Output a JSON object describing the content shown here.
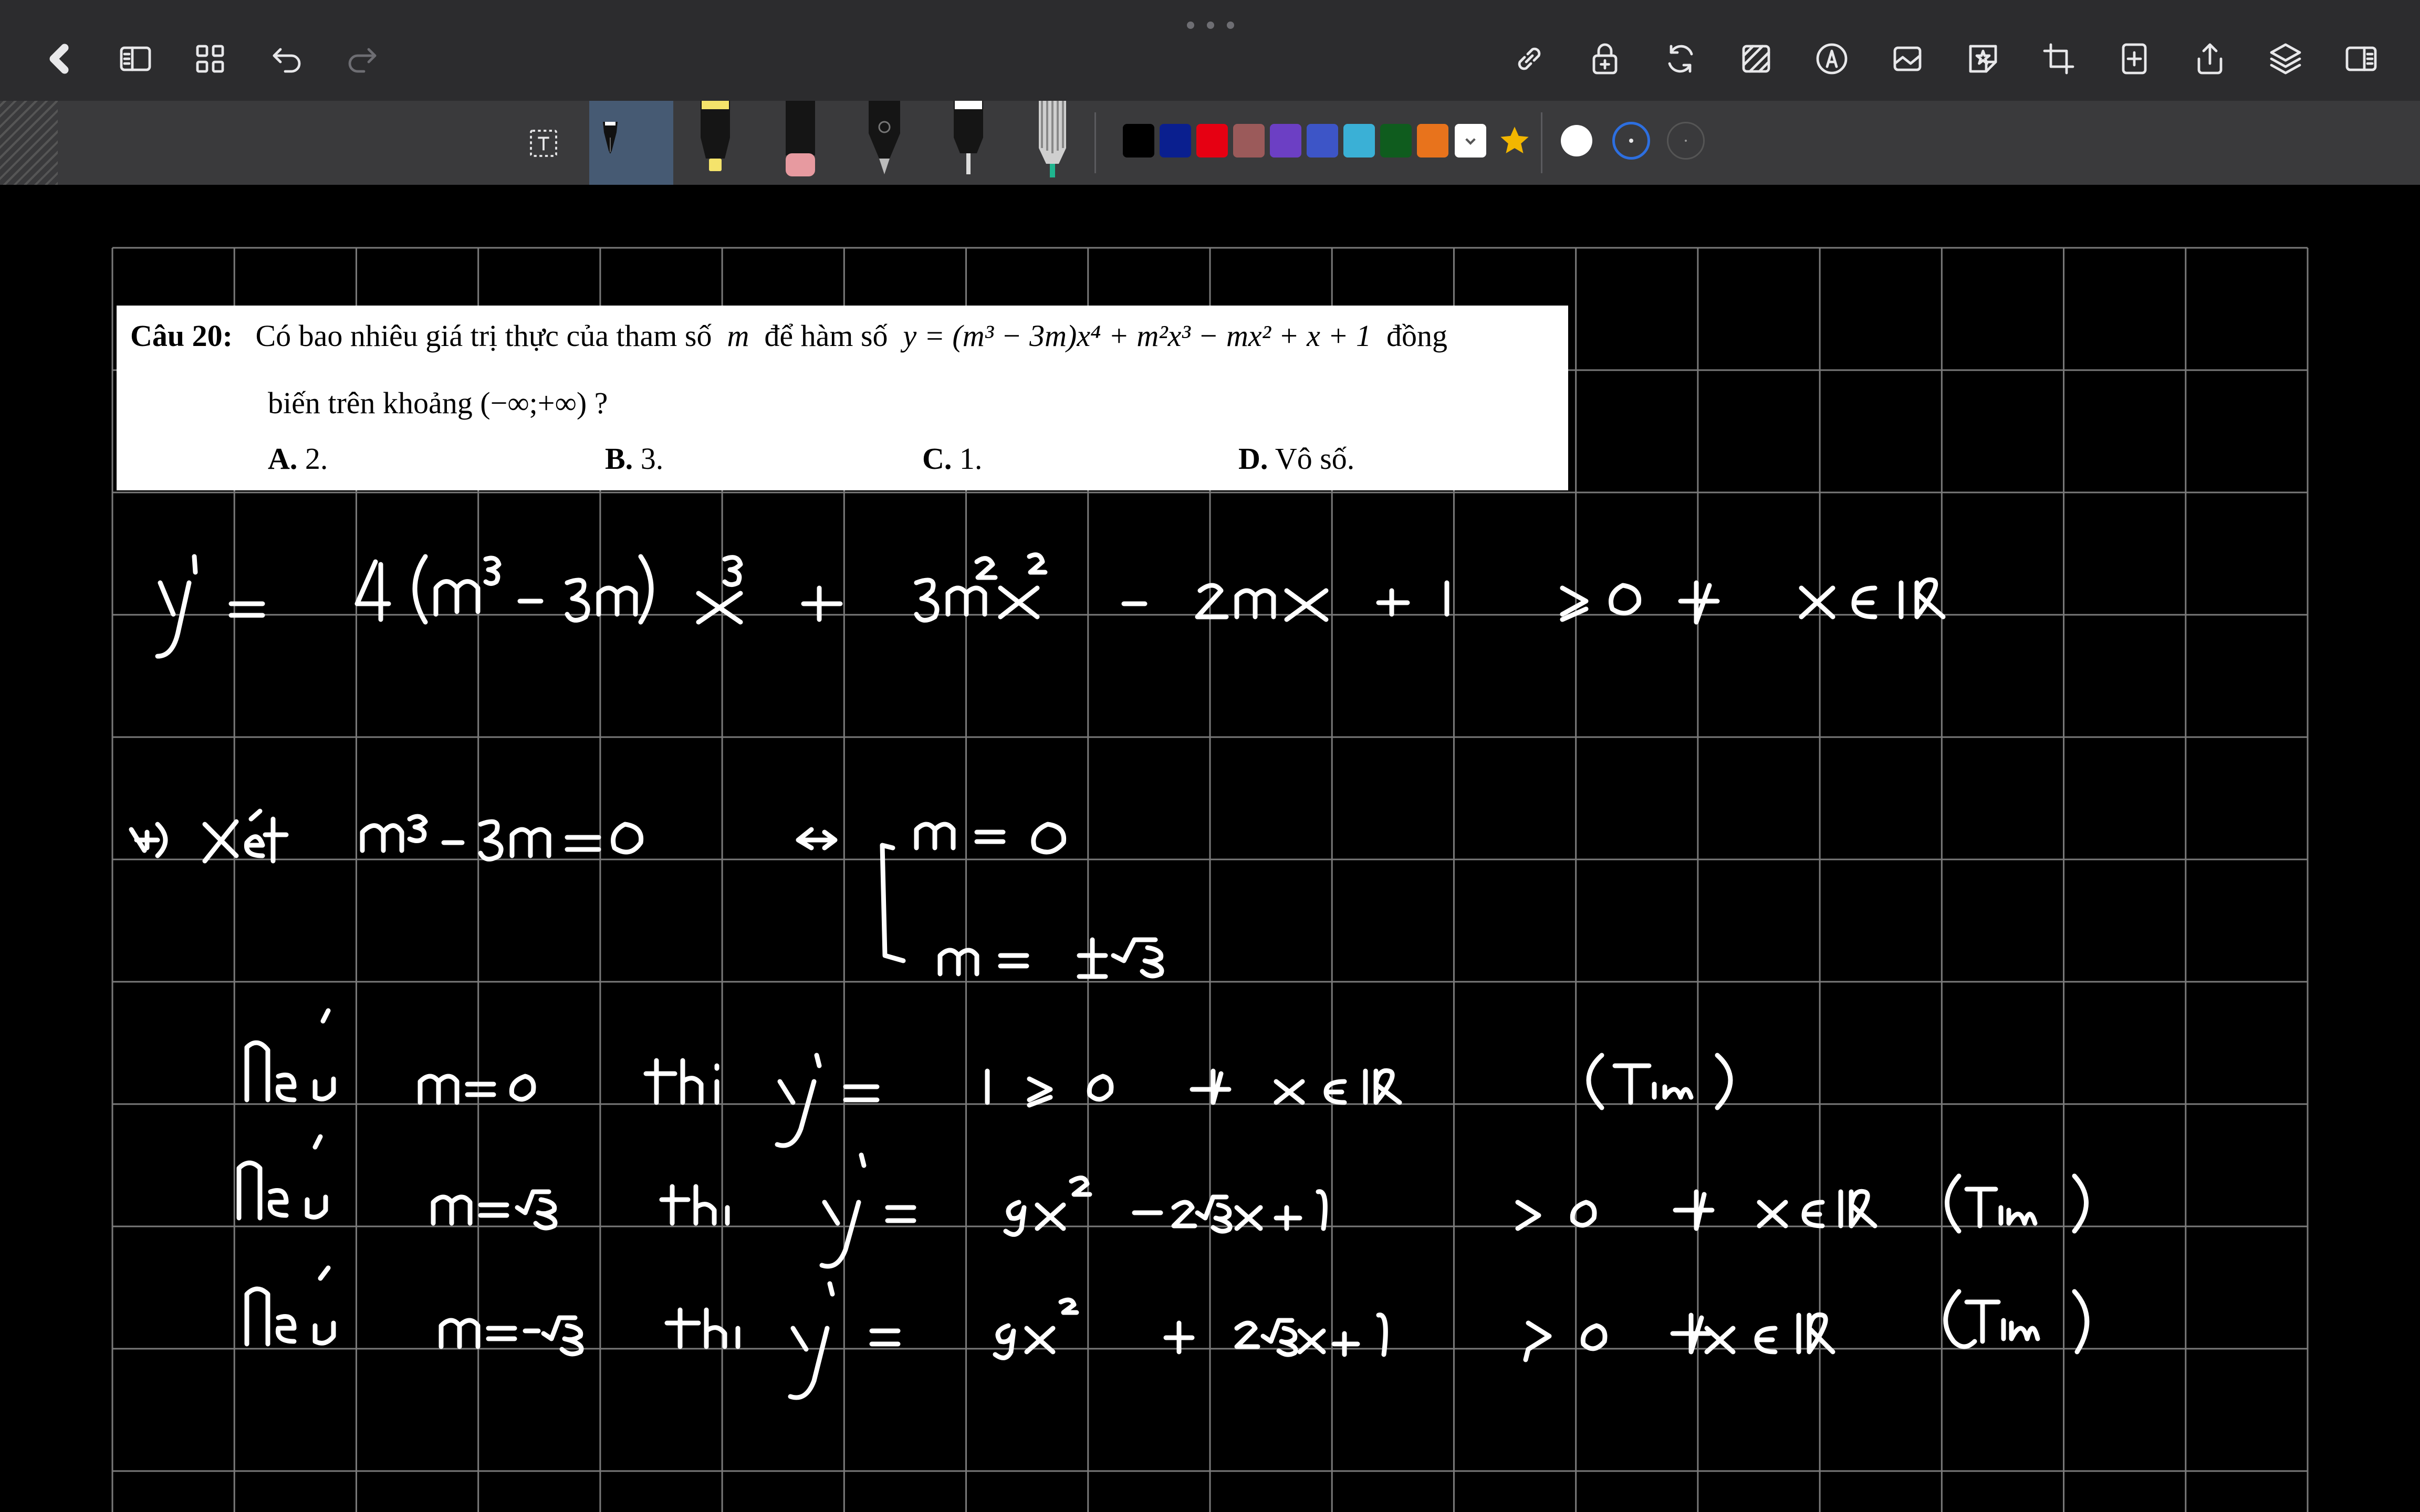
{
  "top_bar": {
    "icons": [
      "back-icon",
      "sidebar-icon",
      "grid-icon",
      "undo-icon",
      "redo-icon",
      "link-icon",
      "lock-icon",
      "sync-icon",
      "pattern-icon",
      "pen-circle-icon",
      "image-icon",
      "sticker-icon",
      "crop-icon",
      "add-page-icon",
      "share-icon",
      "layers-icon",
      "panel-icon"
    ]
  },
  "toolbar": {
    "tools": [
      "text-tool",
      "fountain-pen",
      "highlighter",
      "eraser",
      "brush-pen",
      "fineliner",
      "marker"
    ],
    "colors": [
      "#000000",
      "#0a1f8f",
      "#e60012",
      "#9b5a5a",
      "#6c3fc4",
      "#3d55c7",
      "#3ab0d6",
      "#0f5c1e",
      "#e8731c",
      "#ffffff"
    ],
    "favorite_color": "#f2b600",
    "stroke_sizes": [
      "large",
      "medium",
      "small"
    ]
  },
  "question": {
    "label": "Câu 20:",
    "line1_a": "Có bao nhiêu giá trị thực của tham số",
    "var_m": "m",
    "line1_b": "để hàm số",
    "func": "y = (m³ − 3m)x⁴ + m²x³ − mx² + x + 1",
    "line1_c": "đồng",
    "line2": "biến trên khoảng (−∞;+∞) ?",
    "options": [
      {
        "key": "A.",
        "text": "2."
      },
      {
        "key": "B.",
        "text": "3."
      },
      {
        "key": "C.",
        "text": "1."
      },
      {
        "key": "D.",
        "text": "Vô số."
      }
    ]
  },
  "handwriting": [
    "y' = 4(m³ − 3m) x³ + 3m²x² − 2mx + 1 ≥ 0 ∀ x∈ℝ",
    "+) Xét m³ − 3m = 0 ⇔ [ m = 0 ; m = ±√3",
    "Nếu m=0 thì y' = 1 ≥ 0 ∀ x∈ℝ (Tfm)",
    "Nếu m=√3 thì y' = 9x² − 2√3x + 1 > 0 ∀ x∈ℝ (Tfm)",
    "Nếu m=−√3 thì y' = 9x² + 2√3x + 1 > 0 ∀ x∈ℝ (Tfm)"
  ]
}
